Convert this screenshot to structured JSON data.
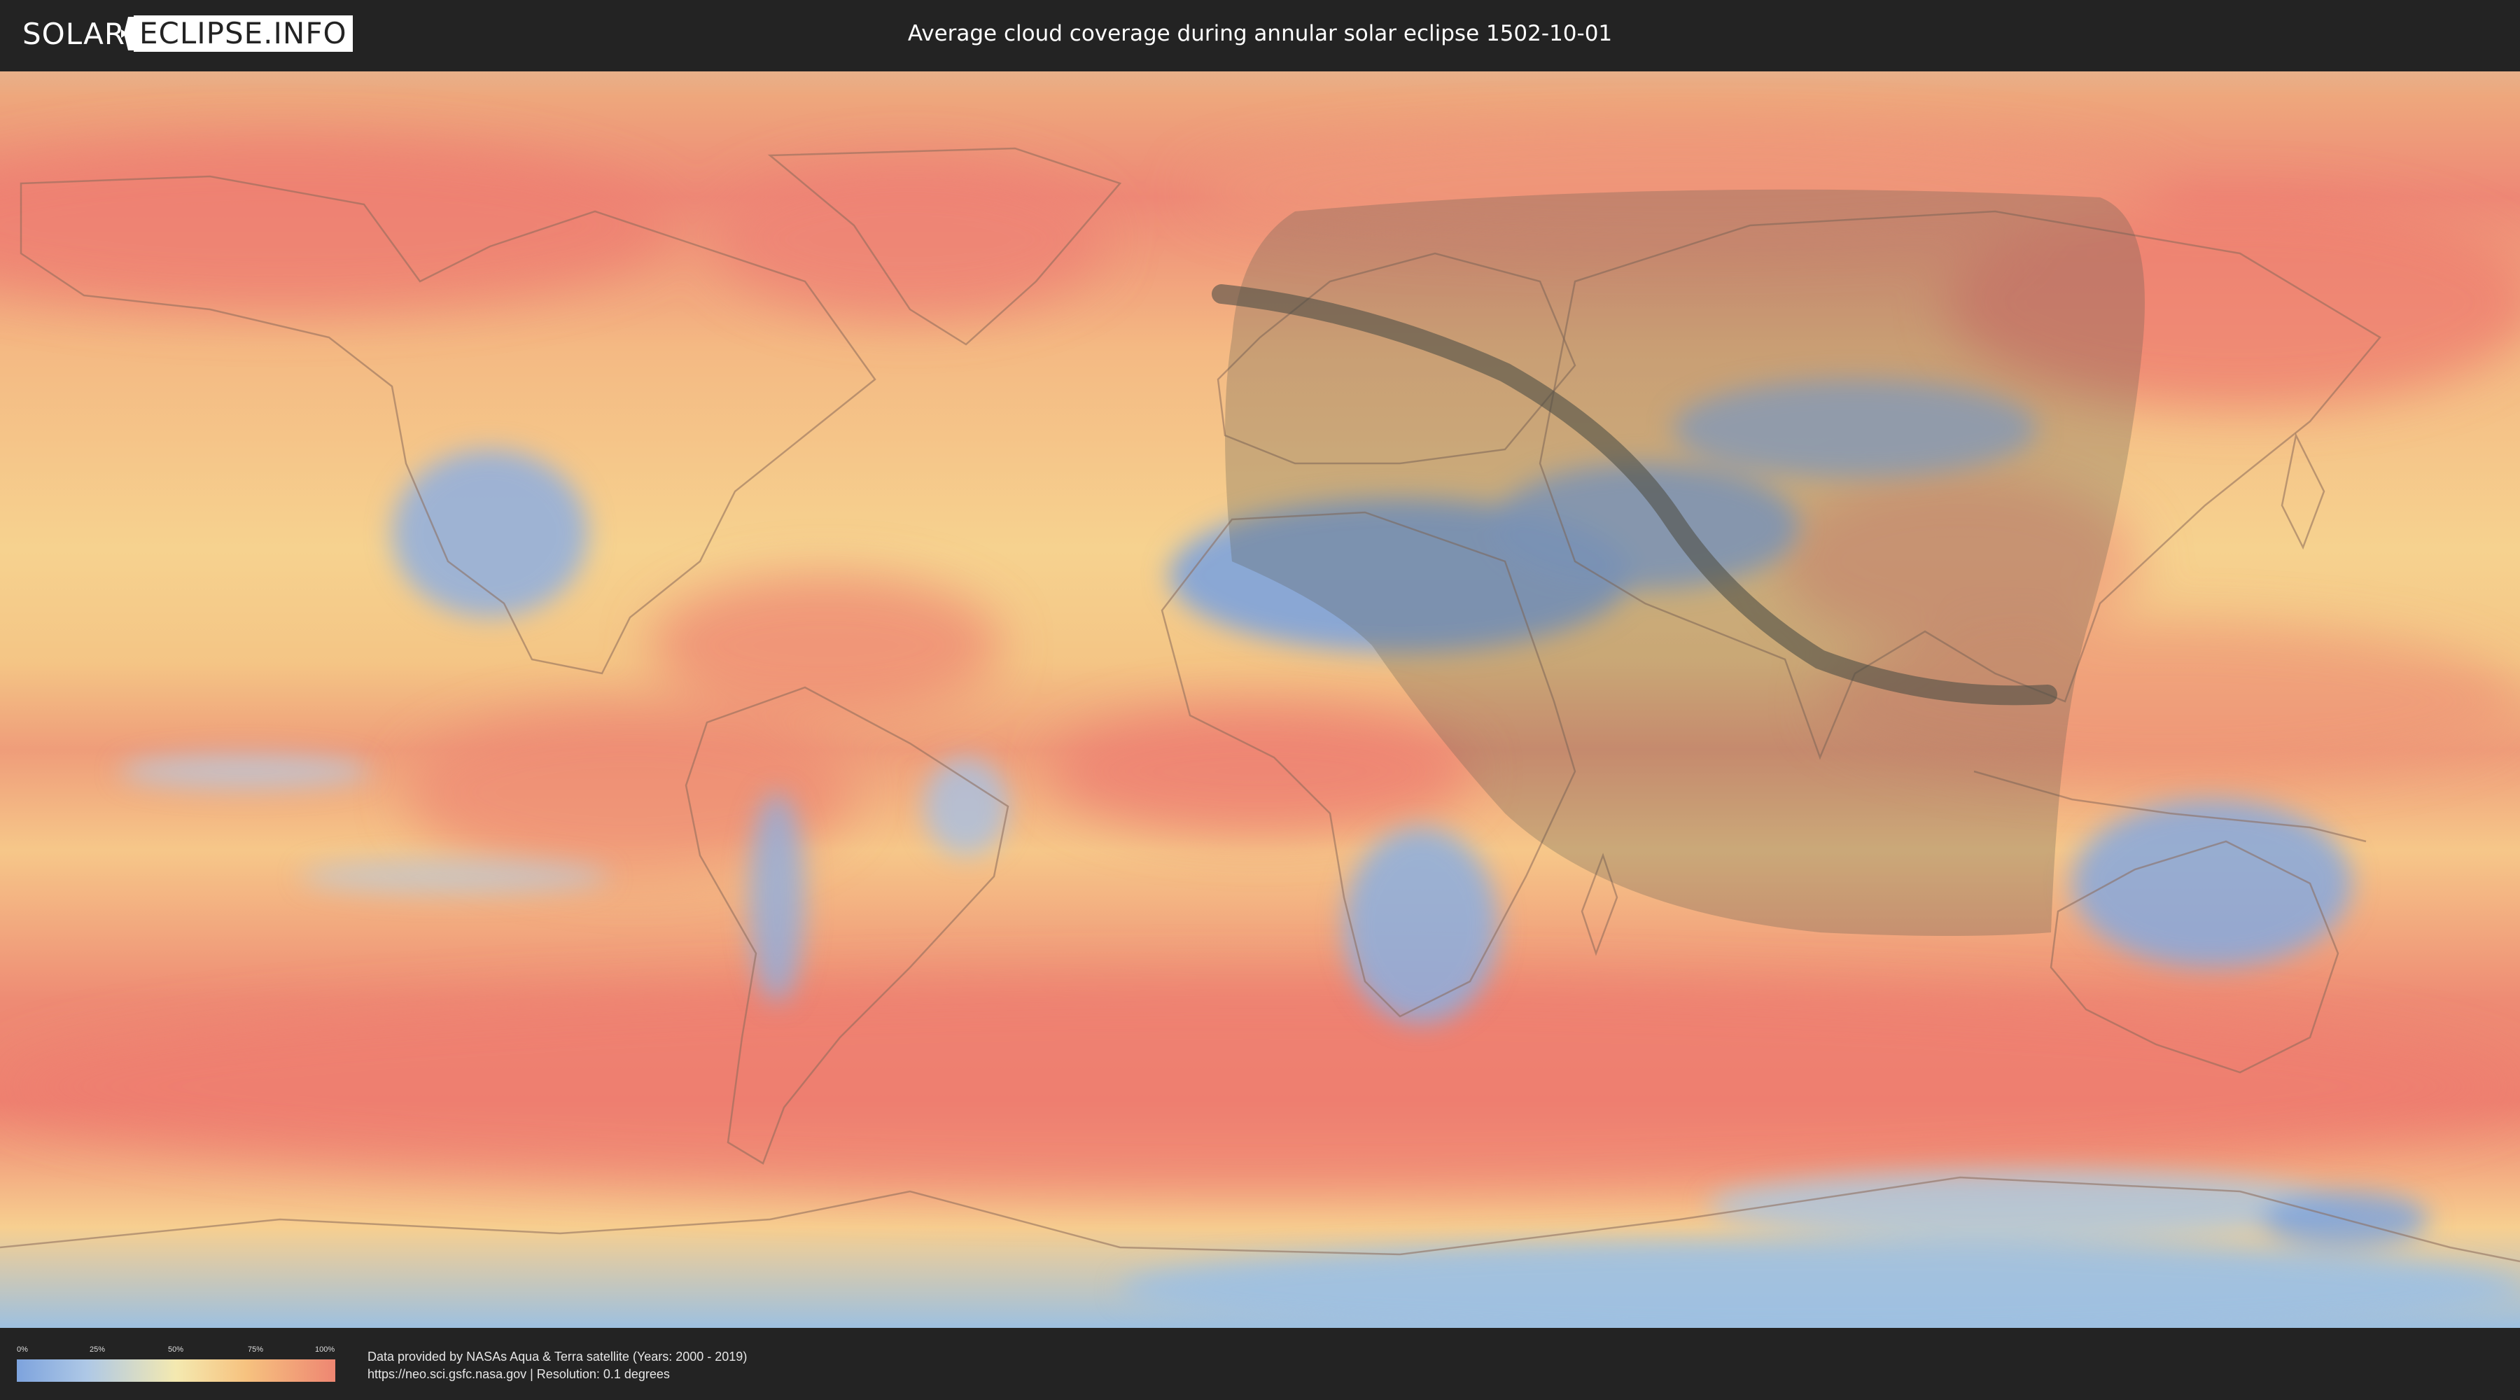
{
  "header": {
    "logo_left": "SOLAR",
    "logo_right": "ECLIPSE.INFO",
    "title": "Average cloud coverage during annular solar eclipse 1502-10-01"
  },
  "legend": {
    "ticks": [
      "0%",
      "25%",
      "50%",
      "75%",
      "100%"
    ],
    "tick_fractions": [
      0,
      0.25,
      0.5,
      0.75,
      1.0
    ],
    "colors": [
      "#7da3dd",
      "#aec8e6",
      "#f4e9b0",
      "#f6c27f",
      "#ee8672"
    ]
  },
  "credits": {
    "line1": "Data provided by NASAs Aqua & Terra satellite (Years: 2000 - 2019)",
    "line2": "https://neo.sci.gsfc.nasa.gov | Resolution: 0.1 degrees"
  },
  "colors": {
    "background": "#232323",
    "clear_sky": "#7da3dd",
    "cloudy": "#ee8672",
    "eclipse_shadow": "#5a5a50"
  },
  "icons": {
    "logo_mark": "eclipse-logo-icon"
  }
}
